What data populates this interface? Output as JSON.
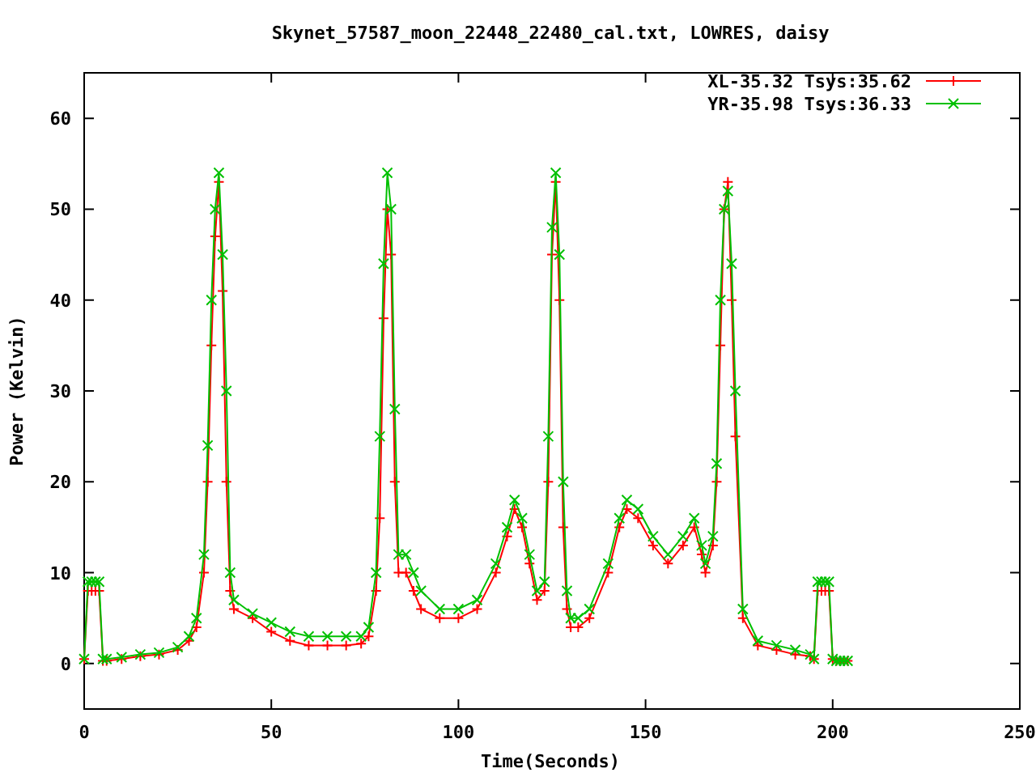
{
  "chart_data": {
    "type": "line",
    "title": "Skynet_57587_moon_22448_22480_cal.txt, LOWRES, daisy",
    "xlabel": "Time(Seconds)",
    "ylabel": "Power (Kelvin)",
    "xlim": [
      0,
      250
    ],
    "ylim": [
      -5,
      65
    ],
    "xticks": [
      0,
      50,
      100,
      150,
      200,
      250
    ],
    "yticks": [
      0,
      10,
      20,
      30,
      40,
      50,
      60
    ],
    "legend": true,
    "x": [
      0,
      1,
      2,
      3,
      4,
      5,
      6,
      10,
      15,
      20,
      25,
      28,
      30,
      32,
      33,
      34,
      35,
      36,
      37,
      38,
      39,
      40,
      45,
      50,
      55,
      60,
      65,
      70,
      74,
      76,
      78,
      79,
      80,
      81,
      82,
      83,
      84,
      86,
      88,
      90,
      95,
      100,
      105,
      110,
      113,
      115,
      117,
      119,
      121,
      123,
      124,
      125,
      126,
      127,
      128,
      129,
      130,
      132,
      135,
      140,
      143,
      145,
      148,
      152,
      156,
      160,
      163,
      165,
      166,
      168,
      169,
      170,
      171,
      172,
      173,
      174,
      176,
      180,
      185,
      190,
      194,
      195,
      196,
      197,
      198,
      199,
      200,
      201,
      202,
      203,
      204
    ],
    "series": [
      {
        "name": "XL-35.32 Tsys:35.62",
        "color": "#ff0000",
        "marker": "plus",
        "values": [
          0.5,
          8,
          8,
          8,
          8,
          0.3,
          0.3,
          0.5,
          0.8,
          1,
          1.5,
          2.5,
          4,
          10,
          20,
          35,
          47,
          53,
          41,
          20,
          8,
          6,
          5,
          3.5,
          2.5,
          2,
          2,
          2,
          2.2,
          3,
          8,
          16,
          38,
          50,
          45,
          20,
          10,
          10,
          8,
          6,
          5,
          5,
          6,
          10,
          14,
          17,
          15,
          11,
          7,
          8,
          20,
          45,
          53,
          40,
          15,
          6,
          4,
          4,
          5,
          10,
          15,
          17,
          16,
          13,
          11,
          13,
          15,
          12,
          10,
          13,
          20,
          35,
          50,
          53,
          40,
          25,
          5,
          2,
          1.5,
          1,
          0.8,
          0.5,
          8,
          8,
          8,
          8,
          0.5,
          0.3,
          0.3,
          0.3,
          0.3
        ]
      },
      {
        "name": "YR-35.98 Tsys:36.33",
        "color": "#00c000",
        "marker": "x",
        "values": [
          0.5,
          9,
          9,
          9,
          9,
          0.5,
          0.5,
          0.7,
          1,
          1.2,
          1.8,
          3,
          5,
          12,
          24,
          40,
          50,
          54,
          45,
          30,
          10,
          7,
          5.5,
          4.5,
          3.5,
          3,
          3,
          3,
          3,
          4,
          10,
          25,
          44,
          54,
          50,
          28,
          12,
          12,
          10,
          8,
          6,
          6,
          7,
          11,
          15,
          18,
          16,
          12,
          8,
          9,
          25,
          48,
          54,
          45,
          20,
          8,
          5,
          5,
          6,
          11,
          16,
          18,
          17,
          14,
          12,
          14,
          16,
          13,
          11,
          14,
          22,
          40,
          50,
          52,
          44,
          30,
          6,
          2.5,
          2,
          1.5,
          1,
          0.5,
          9,
          9,
          9,
          9,
          0.5,
          0.3,
          0.3,
          0.3,
          0.3
        ]
      }
    ]
  }
}
